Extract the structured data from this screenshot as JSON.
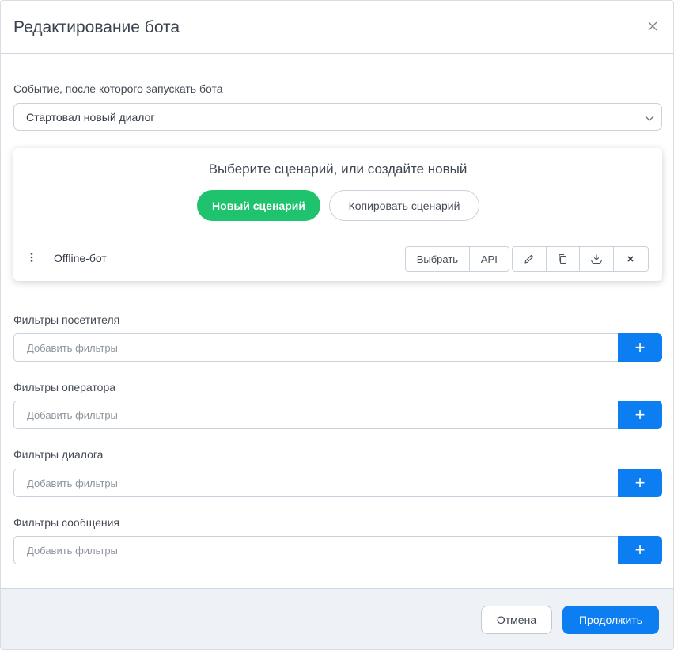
{
  "dialog": {
    "title": "Редактирование бота"
  },
  "event": {
    "label": "Событие, после которого запускать бота",
    "selected": "Стартовал новый диалог"
  },
  "scenario": {
    "heading": "Выберите сценарий, или создайте новый",
    "new_button": "Новый сценарий",
    "copy_button": "Копировать сценарий",
    "item": {
      "name": "Offline-бот",
      "select_button": "Выбрать",
      "api_button": "API"
    }
  },
  "filters": [
    {
      "label": "Фильтры посетителя",
      "placeholder": "Добавить фильтры",
      "add": "+"
    },
    {
      "label": "Фильтры оператора",
      "placeholder": "Добавить фильтры",
      "add": "+"
    },
    {
      "label": "Фильтры диалога",
      "placeholder": "Добавить фильтры",
      "add": "+"
    },
    {
      "label": "Фильтры сообщения",
      "placeholder": "Добавить фильтры",
      "add": "+"
    }
  ],
  "footer": {
    "cancel": "Отмена",
    "continue": "Продолжить"
  },
  "colors": {
    "primary": "#0c7ef2",
    "success": "#1fc26d",
    "footer_bg": "#eef2f6"
  },
  "icons": {
    "close": "close-icon",
    "chevron": "chevron-down-icon",
    "drag": "vertical-dots-icon",
    "edit": "pencil-icon",
    "duplicate": "copy-icon",
    "export": "download-tray-icon",
    "delete": "close-icon"
  }
}
